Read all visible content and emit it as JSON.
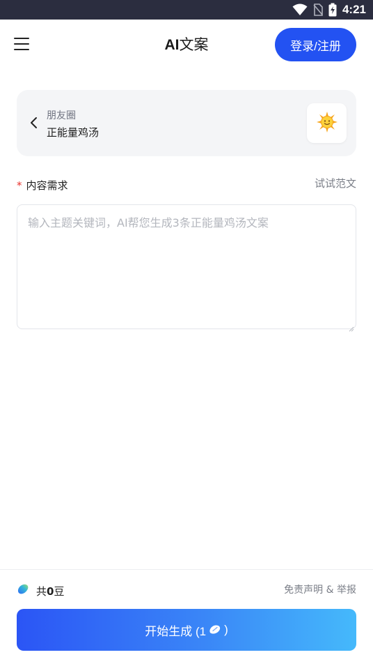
{
  "status_bar": {
    "time": "4:21",
    "icons": [
      "wifi-icon",
      "no-sim-icon",
      "battery-charging-icon"
    ]
  },
  "header": {
    "title_prefix": "AI",
    "title_suffix": "文案",
    "login_label": "登录/注册",
    "menu_icon": "menu-icon",
    "accent": "#2352f2"
  },
  "template": {
    "category": "朋友圈",
    "name": "正能量鸡汤",
    "icon": "sun-emoji-icon"
  },
  "requirement": {
    "label": "内容需求",
    "required_mark": "*",
    "try_example": "试试范文",
    "placeholder": "输入主题关键词，AI帮您生成3条正能量鸡汤文案",
    "value": ""
  },
  "footer": {
    "beans_prefix": "共",
    "beans_count": "0",
    "beans_unit": "豆",
    "disclaimer": "免责声明 & 举报",
    "generate_label": "开始生成 (1",
    "generate_suffix": ")",
    "bean_icon": "bean-icon"
  }
}
